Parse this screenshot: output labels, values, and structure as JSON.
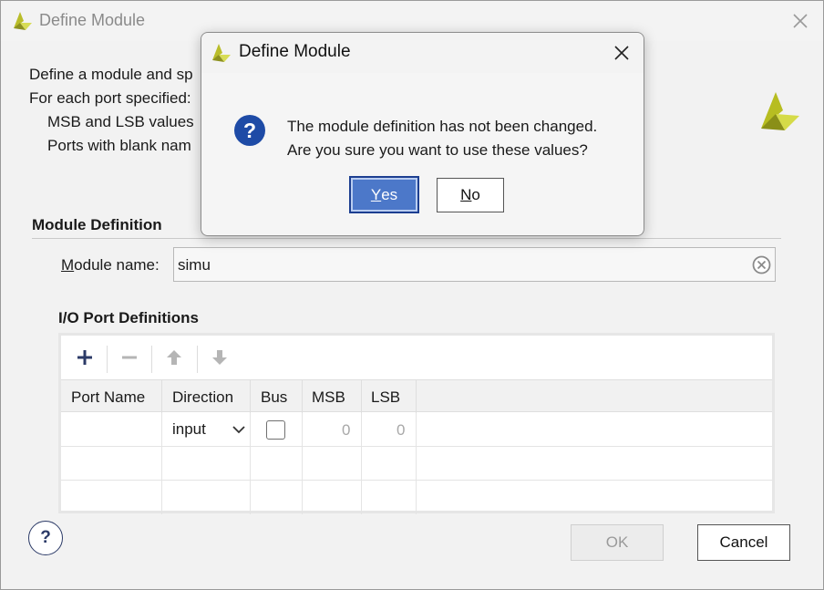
{
  "window": {
    "title": "Define Module"
  },
  "intro": {
    "line1": "Define a module and sp",
    "line2": "For each port specified:",
    "line3": "MSB and LSB values",
    "line4": "Ports with blank nam"
  },
  "module_definition": {
    "section_title": "Module Definition",
    "name_label_mnemonic": "M",
    "name_label_rest": "odule name:",
    "name_value": "simu"
  },
  "io_ports": {
    "section_title": "I/O Port Definitions",
    "toolbar": {
      "add_icon": "plus-icon",
      "remove_icon": "minus-icon",
      "up_icon": "arrow-up-icon",
      "down_icon": "arrow-down-icon"
    },
    "columns": [
      "Port Name",
      "Direction",
      "Bus",
      "MSB",
      "LSB"
    ],
    "rows": [
      {
        "port_name": "",
        "direction": "input",
        "bus": false,
        "msb": "0",
        "lsb": "0"
      }
    ]
  },
  "buttons": {
    "ok": "OK",
    "cancel": "Cancel",
    "help": "?"
  },
  "modal": {
    "title": "Define Module",
    "message_line1": "The module definition has not been changed.",
    "message_line2": "Are you sure you want to use these values?",
    "yes_mnemonic": "Y",
    "yes_rest": "es",
    "no_mnemonic": "N",
    "no_rest": "o",
    "icon": "question-icon",
    "icon_glyph": "?"
  },
  "colors": {
    "accent": "#4c78c9",
    "question_icon": "#1e4ba6",
    "logo_yellow": "#c8cf2c"
  }
}
